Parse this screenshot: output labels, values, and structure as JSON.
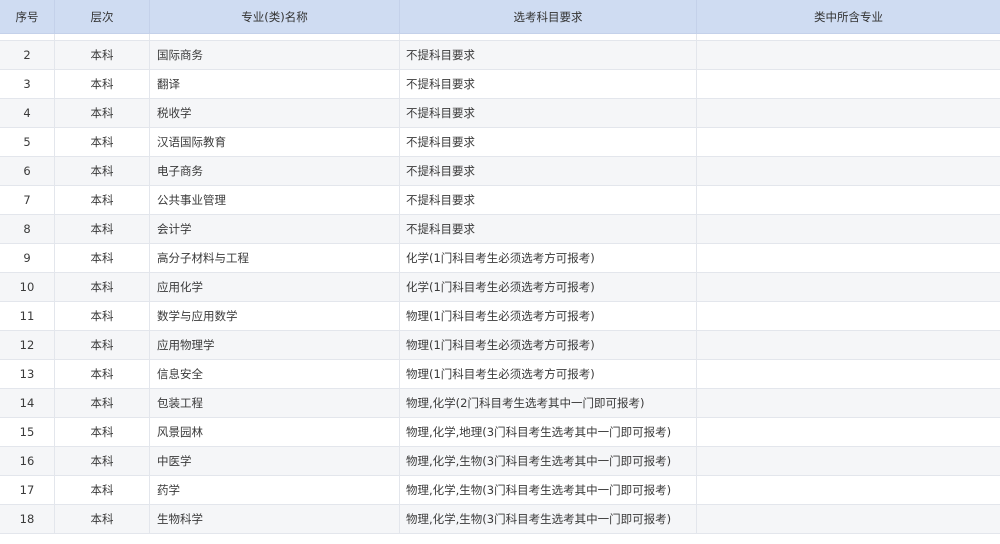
{
  "table": {
    "headers": {
      "index": "序号",
      "level": "层次",
      "major": "专业(类)名称",
      "requirement": "选考科目要求",
      "sub_majors": "类中所含专业"
    },
    "rows": [
      {
        "index": "2",
        "level": "本科",
        "major": "国际商务",
        "requirement": "不提科目要求",
        "sub_majors": ""
      },
      {
        "index": "3",
        "level": "本科",
        "major": "翻译",
        "requirement": "不提科目要求",
        "sub_majors": ""
      },
      {
        "index": "4",
        "level": "本科",
        "major": "税收学",
        "requirement": "不提科目要求",
        "sub_majors": ""
      },
      {
        "index": "5",
        "level": "本科",
        "major": "汉语国际教育",
        "requirement": "不提科目要求",
        "sub_majors": ""
      },
      {
        "index": "6",
        "level": "本科",
        "major": "电子商务",
        "requirement": "不提科目要求",
        "sub_majors": ""
      },
      {
        "index": "7",
        "level": "本科",
        "major": "公共事业管理",
        "requirement": "不提科目要求",
        "sub_majors": ""
      },
      {
        "index": "8",
        "level": "本科",
        "major": "会计学",
        "requirement": "不提科目要求",
        "sub_majors": ""
      },
      {
        "index": "9",
        "level": "本科",
        "major": "高分子材料与工程",
        "requirement": "化学(1门科目考生必须选考方可报考)",
        "sub_majors": ""
      },
      {
        "index": "10",
        "level": "本科",
        "major": "应用化学",
        "requirement": "化学(1门科目考生必须选考方可报考)",
        "sub_majors": ""
      },
      {
        "index": "11",
        "level": "本科",
        "major": "数学与应用数学",
        "requirement": "物理(1门科目考生必须选考方可报考)",
        "sub_majors": ""
      },
      {
        "index": "12",
        "level": "本科",
        "major": "应用物理学",
        "requirement": "物理(1门科目考生必须选考方可报考)",
        "sub_majors": ""
      },
      {
        "index": "13",
        "level": "本科",
        "major": "信息安全",
        "requirement": "物理(1门科目考生必须选考方可报考)",
        "sub_majors": ""
      },
      {
        "index": "14",
        "level": "本科",
        "major": "包装工程",
        "requirement": "物理,化学(2门科目考生选考其中一门即可报考)",
        "sub_majors": ""
      },
      {
        "index": "15",
        "level": "本科",
        "major": "风景园林",
        "requirement": "物理,化学,地理(3门科目考生选考其中一门即可报考)",
        "sub_majors": ""
      },
      {
        "index": "16",
        "level": "本科",
        "major": "中医学",
        "requirement": "物理,化学,生物(3门科目考生选考其中一门即可报考)",
        "sub_majors": ""
      },
      {
        "index": "17",
        "level": "本科",
        "major": "药学",
        "requirement": "物理,化学,生物(3门科目考生选考其中一门即可报考)",
        "sub_majors": ""
      },
      {
        "index": "18",
        "level": "本科",
        "major": "生物科学",
        "requirement": "物理,化学,生物(3门科目考生选考其中一门即可报考)",
        "sub_majors": ""
      }
    ]
  }
}
